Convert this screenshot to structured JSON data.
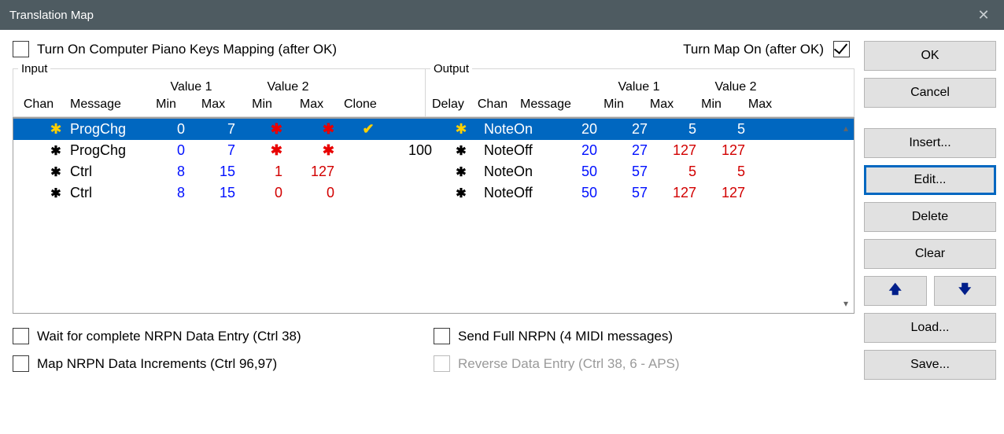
{
  "title": "Translation Map",
  "checks": {
    "pianoKeys": "Turn On Computer Piano Keys Mapping (after OK)",
    "turnMapOn": "Turn Map On (after OK)",
    "waitNRPN": "Wait for complete NRPN Data Entry (Ctrl 38)",
    "mapNRPN": "Map NRPN Data Increments (Ctrl 96,97)",
    "sendFull": "Send Full NRPN (4 MIDI messages)",
    "reverse": "Reverse Data Entry (Ctrl 38, 6 - APS)"
  },
  "groups": {
    "input": "Input",
    "output": "Output",
    "v1": "Value 1",
    "v2": "Value 2"
  },
  "columns": {
    "chan": "Chan",
    "message": "Message",
    "min": "Min",
    "max": "Max",
    "clone": "Clone",
    "delay": "Delay"
  },
  "buttons": {
    "ok": "OK",
    "cancel": "Cancel",
    "insert": "Insert...",
    "edit": "Edit...",
    "delete": "Delete",
    "clear": "Clear",
    "load": "Load...",
    "save": "Save..."
  },
  "rows": [
    {
      "sel": true,
      "in": {
        "chan": "✱",
        "msg": "ProgChg",
        "v1min": "0",
        "v1max": "7",
        "v2min": "✱",
        "v2max": "✱",
        "clone": "✔"
      },
      "out": {
        "delay": "",
        "chan": "✱",
        "msg": "NoteOn",
        "v1min": "20",
        "v1max": "27",
        "v2min": "5",
        "v2max": "5"
      }
    },
    {
      "sel": false,
      "in": {
        "chan": "✱",
        "msg": "ProgChg",
        "v1min": "0",
        "v1max": "7",
        "v2min": "✱",
        "v2max": "✱",
        "clone": ""
      },
      "out": {
        "delay": "100",
        "chan": "✱",
        "msg": "NoteOff",
        "v1min": "20",
        "v1max": "27",
        "v2min": "127",
        "v2max": "127"
      }
    },
    {
      "sel": false,
      "in": {
        "chan": "✱",
        "msg": "Ctrl",
        "v1min": "8",
        "v1max": "15",
        "v2min": "1",
        "v2max": "127",
        "clone": ""
      },
      "out": {
        "delay": "",
        "chan": "✱",
        "msg": "NoteOn",
        "v1min": "50",
        "v1max": "57",
        "v2min": "5",
        "v2max": "5"
      }
    },
    {
      "sel": false,
      "in": {
        "chan": "✱",
        "msg": "Ctrl",
        "v1min": "8",
        "v1max": "15",
        "v2min": "0",
        "v2max": "0",
        "clone": ""
      },
      "out": {
        "delay": "",
        "chan": "✱",
        "msg": "NoteOff",
        "v1min": "50",
        "v1max": "57",
        "v2min": "127",
        "v2max": "127"
      }
    }
  ]
}
